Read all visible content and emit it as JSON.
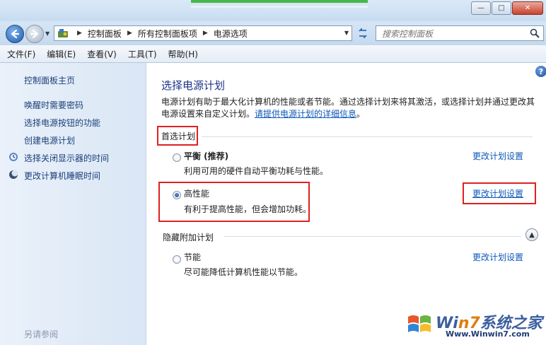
{
  "titlebar": {
    "minimize": "—",
    "maximize": "□",
    "close": "✕"
  },
  "address": {
    "crumbs": [
      "控制面板",
      "所有控制面板项",
      "电源选项"
    ],
    "search_placeholder": "搜索控制面板"
  },
  "menu": [
    "文件(F)",
    "编辑(E)",
    "查看(V)",
    "工具(T)",
    "帮助(H)"
  ],
  "sidebar": {
    "home": "控制面板主页",
    "links": [
      "唤醒时需要密码",
      "选择电源按钮的功能",
      "创建电源计划",
      "选择关闭显示器的时间",
      "更改计算机睡眠时间"
    ],
    "see_also": "另请参阅"
  },
  "main": {
    "title": "选择电源计划",
    "desc_line1": "电源计划有助于最大化计算机的性能或者节能。通过选择计划来将其激活，或选择计划并通过更改其",
    "desc_line2": "电源设置来自定义计划。",
    "desc_link": "请提供电源计划的详细信息",
    "desc_end": "。",
    "preferred_header": "首选计划",
    "hidden_header": "隐藏附加计划",
    "change_label": "更改计划设置",
    "plans": [
      {
        "name": "平衡 (推荐)",
        "desc": "利用可用的硬件自动平衡功耗与性能。",
        "selected": false
      },
      {
        "name": "高性能",
        "desc": "有利于提高性能，但会增加功耗。",
        "selected": true
      },
      {
        "name": "节能",
        "desc": "尽可能降低计算机性能以节能。",
        "selected": false
      }
    ]
  },
  "watermark": {
    "brand_a": "Wi",
    "brand_b": "n7",
    "brand_c": "系统之家",
    "url": "Www.Winwin7.com"
  },
  "colors": {
    "link": "#0d57b8",
    "title": "#1e3287",
    "highlight": "#e02020"
  }
}
